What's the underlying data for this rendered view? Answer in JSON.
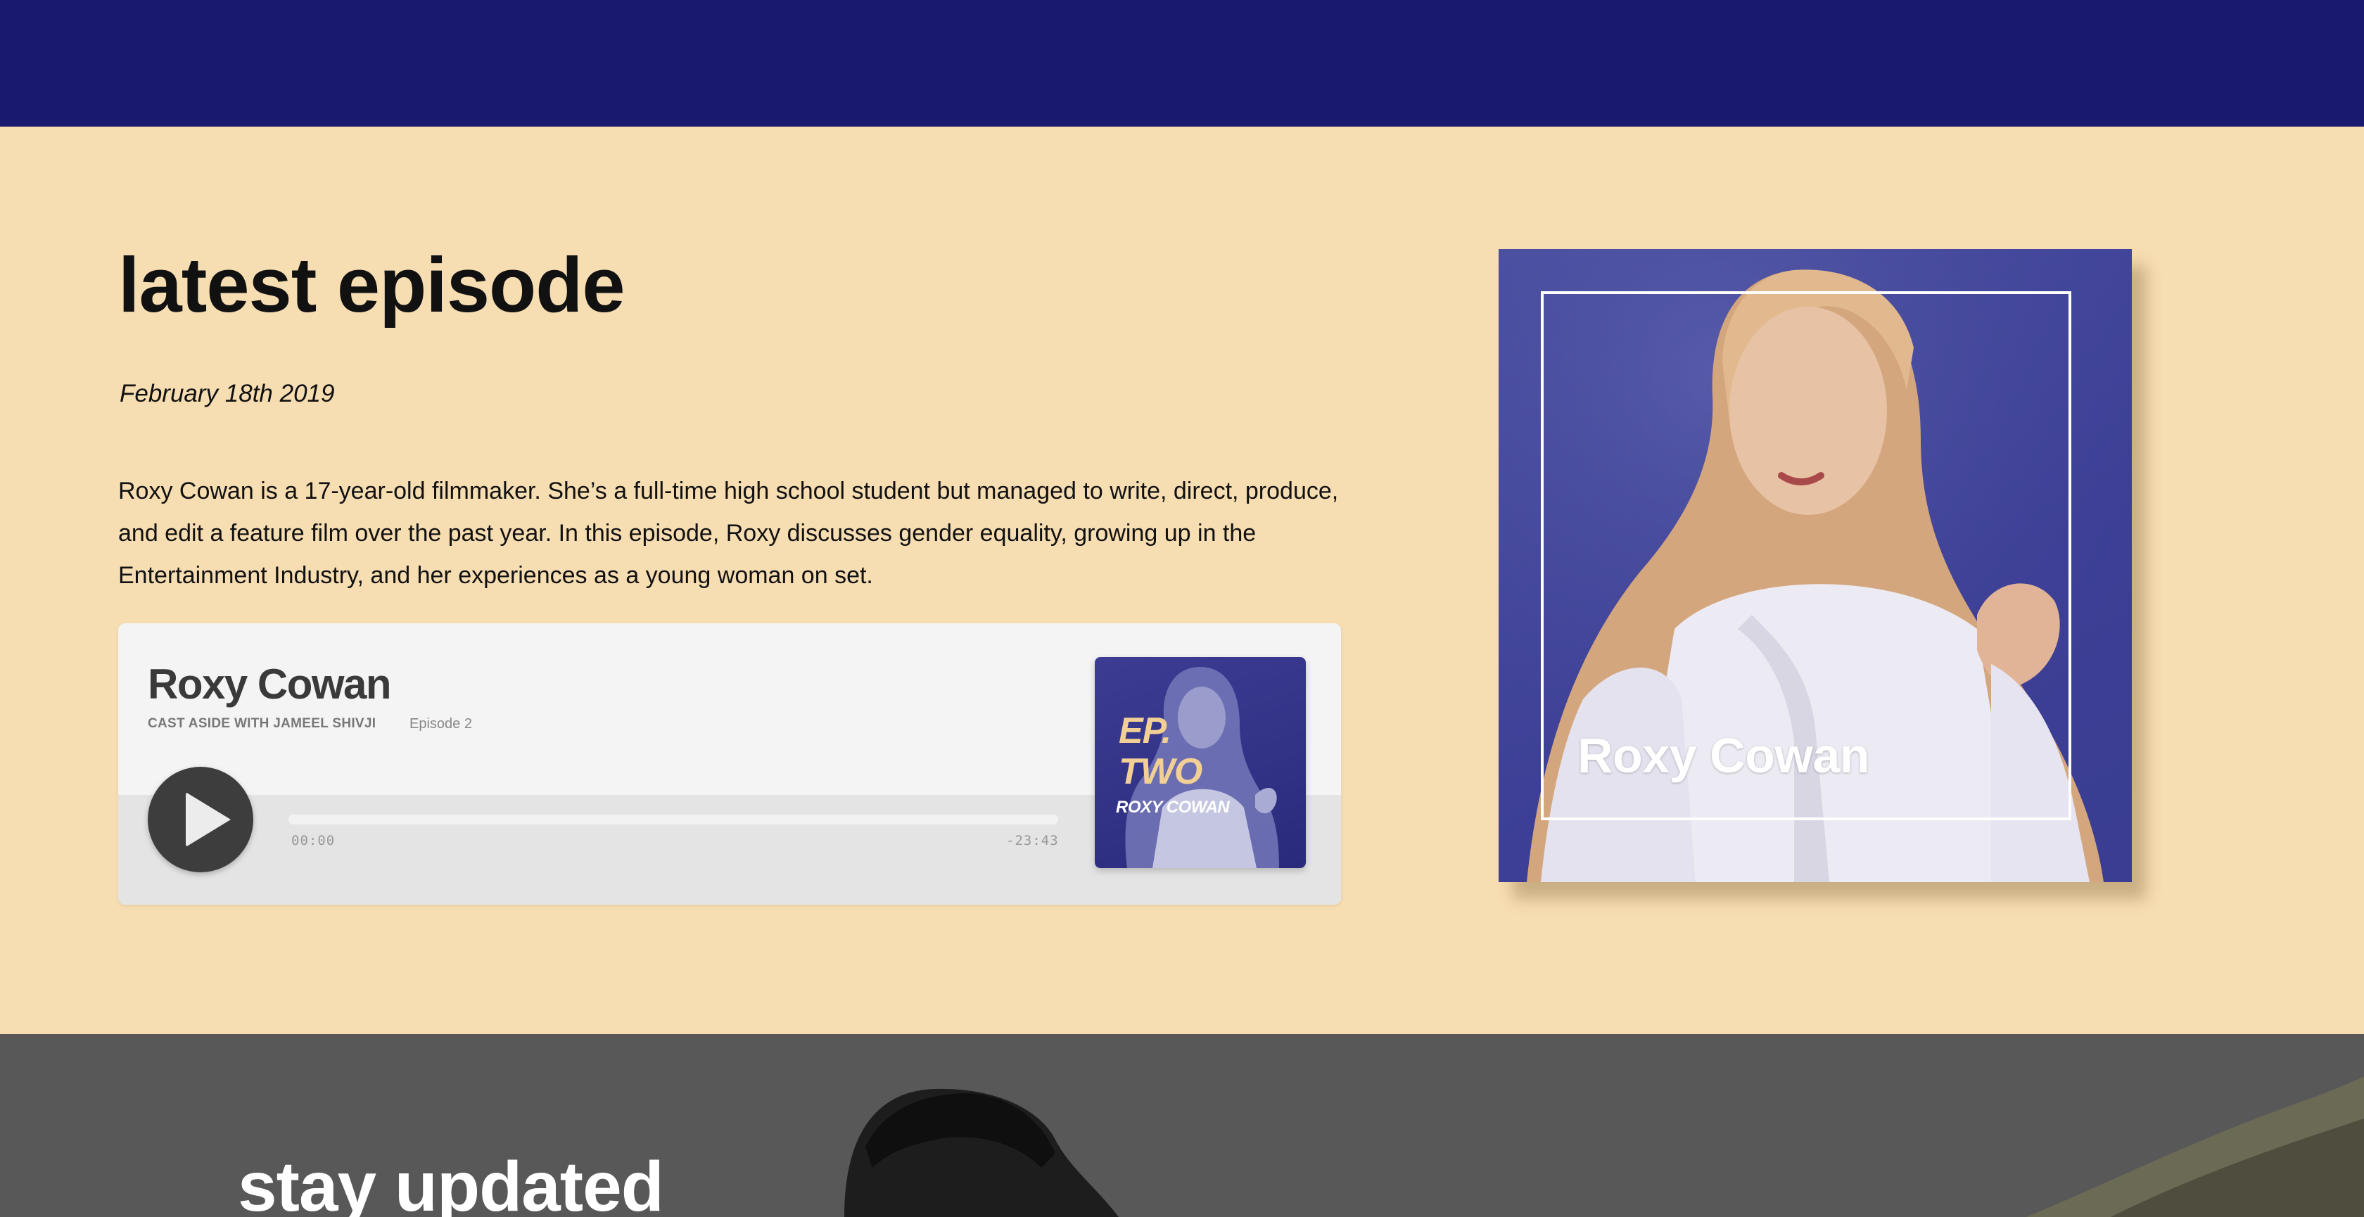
{
  "colors": {
    "header_bg": "#191970",
    "section_bg": "#f7ddb2",
    "footer_bg": "#585858",
    "accent_gold": "#f2cf95",
    "hero_blue": "#3c3f95"
  },
  "latest": {
    "heading": "latest episode",
    "date": "February 18th 2019",
    "description": "Roxy Cowan is a 17-year-old filmmaker. She’s a full-time high school student but managed to write, direct, produce, and edit a feature film over the past year. In this episode, Roxy discusses gender equality, growing up in the Entertainment Industry, and her experiences as a young woman on set."
  },
  "player": {
    "title": "Roxy Cowan",
    "show": "CAST ASIDE WITH JAMEEL SHIVJI",
    "episode": "Episode 2",
    "time_elapsed": "00:00",
    "time_remaining": "-23:43",
    "progress": 0,
    "cover": {
      "ep_line1": "EP.",
      "ep_line2": "TWO",
      "name": "ROXY COWAN"
    },
    "play_icon": "play-icon"
  },
  "hero": {
    "name": "Roxy Cowan"
  },
  "updates": {
    "heading": "stay updated"
  }
}
